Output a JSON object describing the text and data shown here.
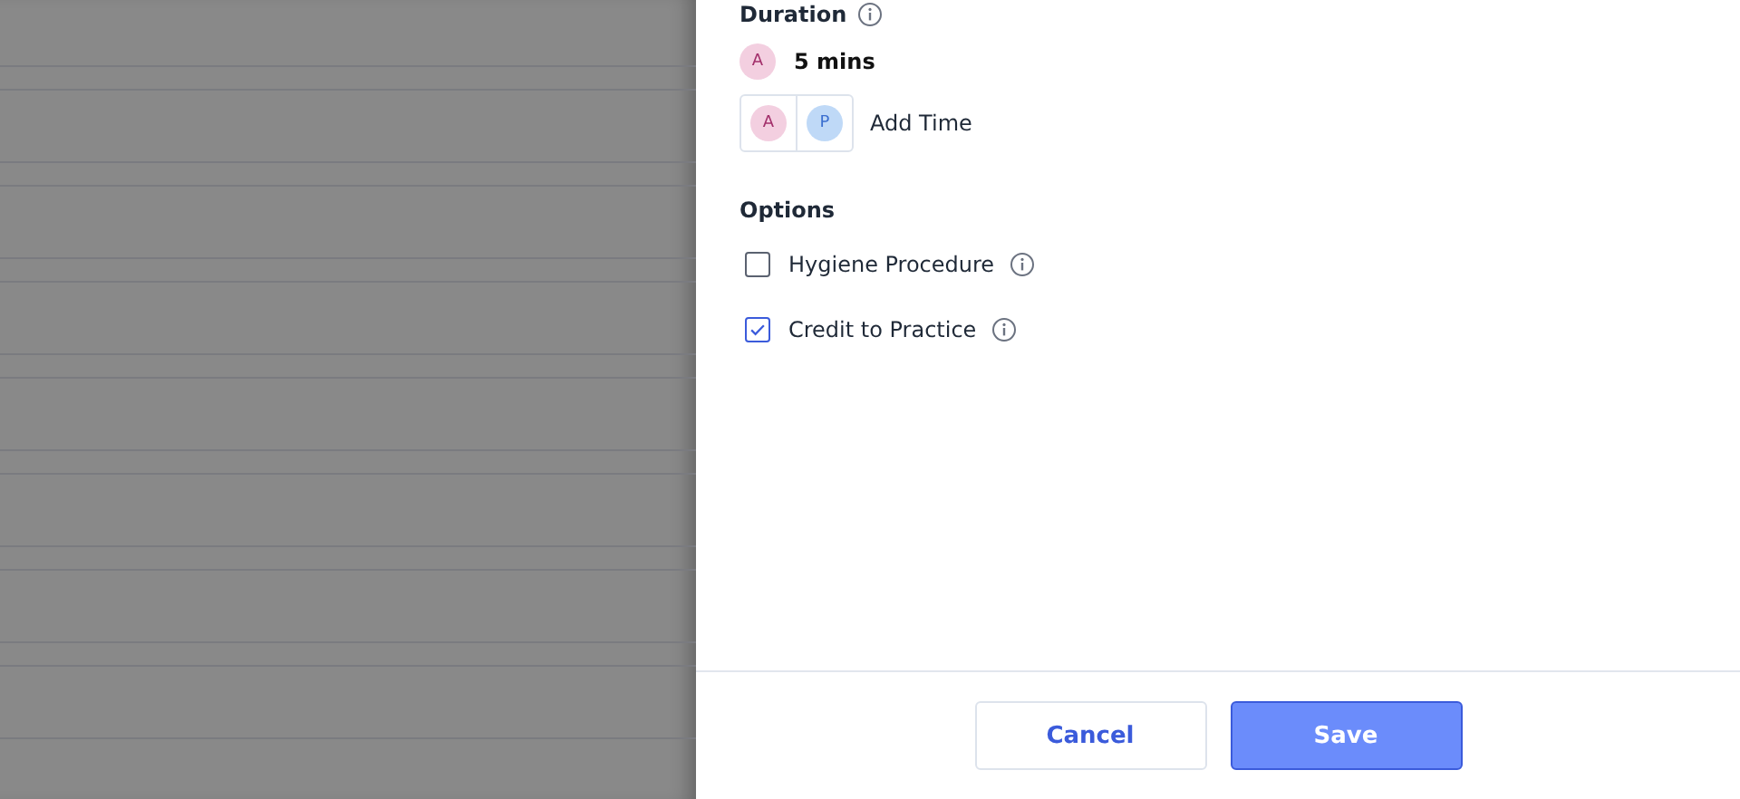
{
  "duration": {
    "title": "Duration",
    "avatar": {
      "initial": "A",
      "kind": "a"
    },
    "value": "5 mins",
    "add_time": {
      "avatars": [
        {
          "initial": "A",
          "kind": "a"
        },
        {
          "initial": "P",
          "kind": "p"
        }
      ],
      "label": "Add Time"
    }
  },
  "options": {
    "title": "Options",
    "items": [
      {
        "label": "Hygiene Procedure",
        "checked": false
      },
      {
        "label": "Credit to Practice",
        "checked": true
      }
    ]
  },
  "buttons": [
    {
      "label": "Cancel",
      "kind": "secondary"
    },
    {
      "label": "Save",
      "kind": "primary"
    }
  ]
}
